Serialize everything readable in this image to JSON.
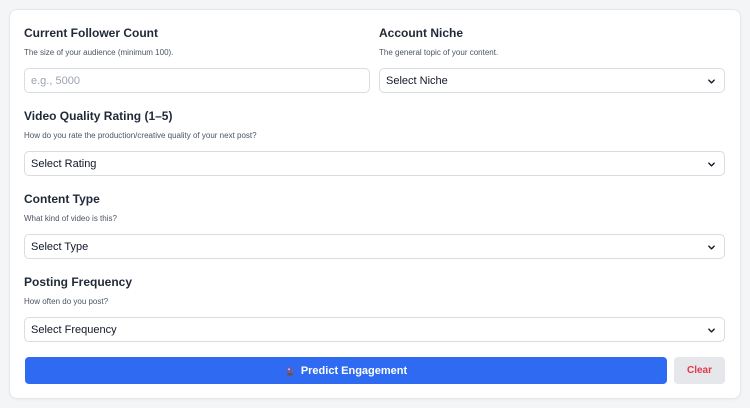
{
  "form": {
    "follower": {
      "label": "Current Follower Count",
      "help": "The size of your audience (minimum 100).",
      "placeholder": "e.g., 5000"
    },
    "niche": {
      "label": "Account Niche",
      "help": "The general topic of your content.",
      "selected": "Select Niche"
    },
    "quality": {
      "label": "Video Quality Rating (1–5)",
      "help": "How do you rate the production/creative quality of your next post?",
      "selected": "Select Rating"
    },
    "content_type": {
      "label": "Content Type",
      "help": "What kind of video is this?",
      "selected": "Select Type"
    },
    "frequency": {
      "label": "Posting Frequency",
      "help": "How often do you post?",
      "selected": "Select Frequency"
    }
  },
  "actions": {
    "predict_label": "Predict Engagement",
    "clear_label": "Clear"
  },
  "colors": {
    "primary": "#2f6bf2",
    "clear_text": "#e0384c",
    "clear_bg": "#e5e7eb"
  }
}
